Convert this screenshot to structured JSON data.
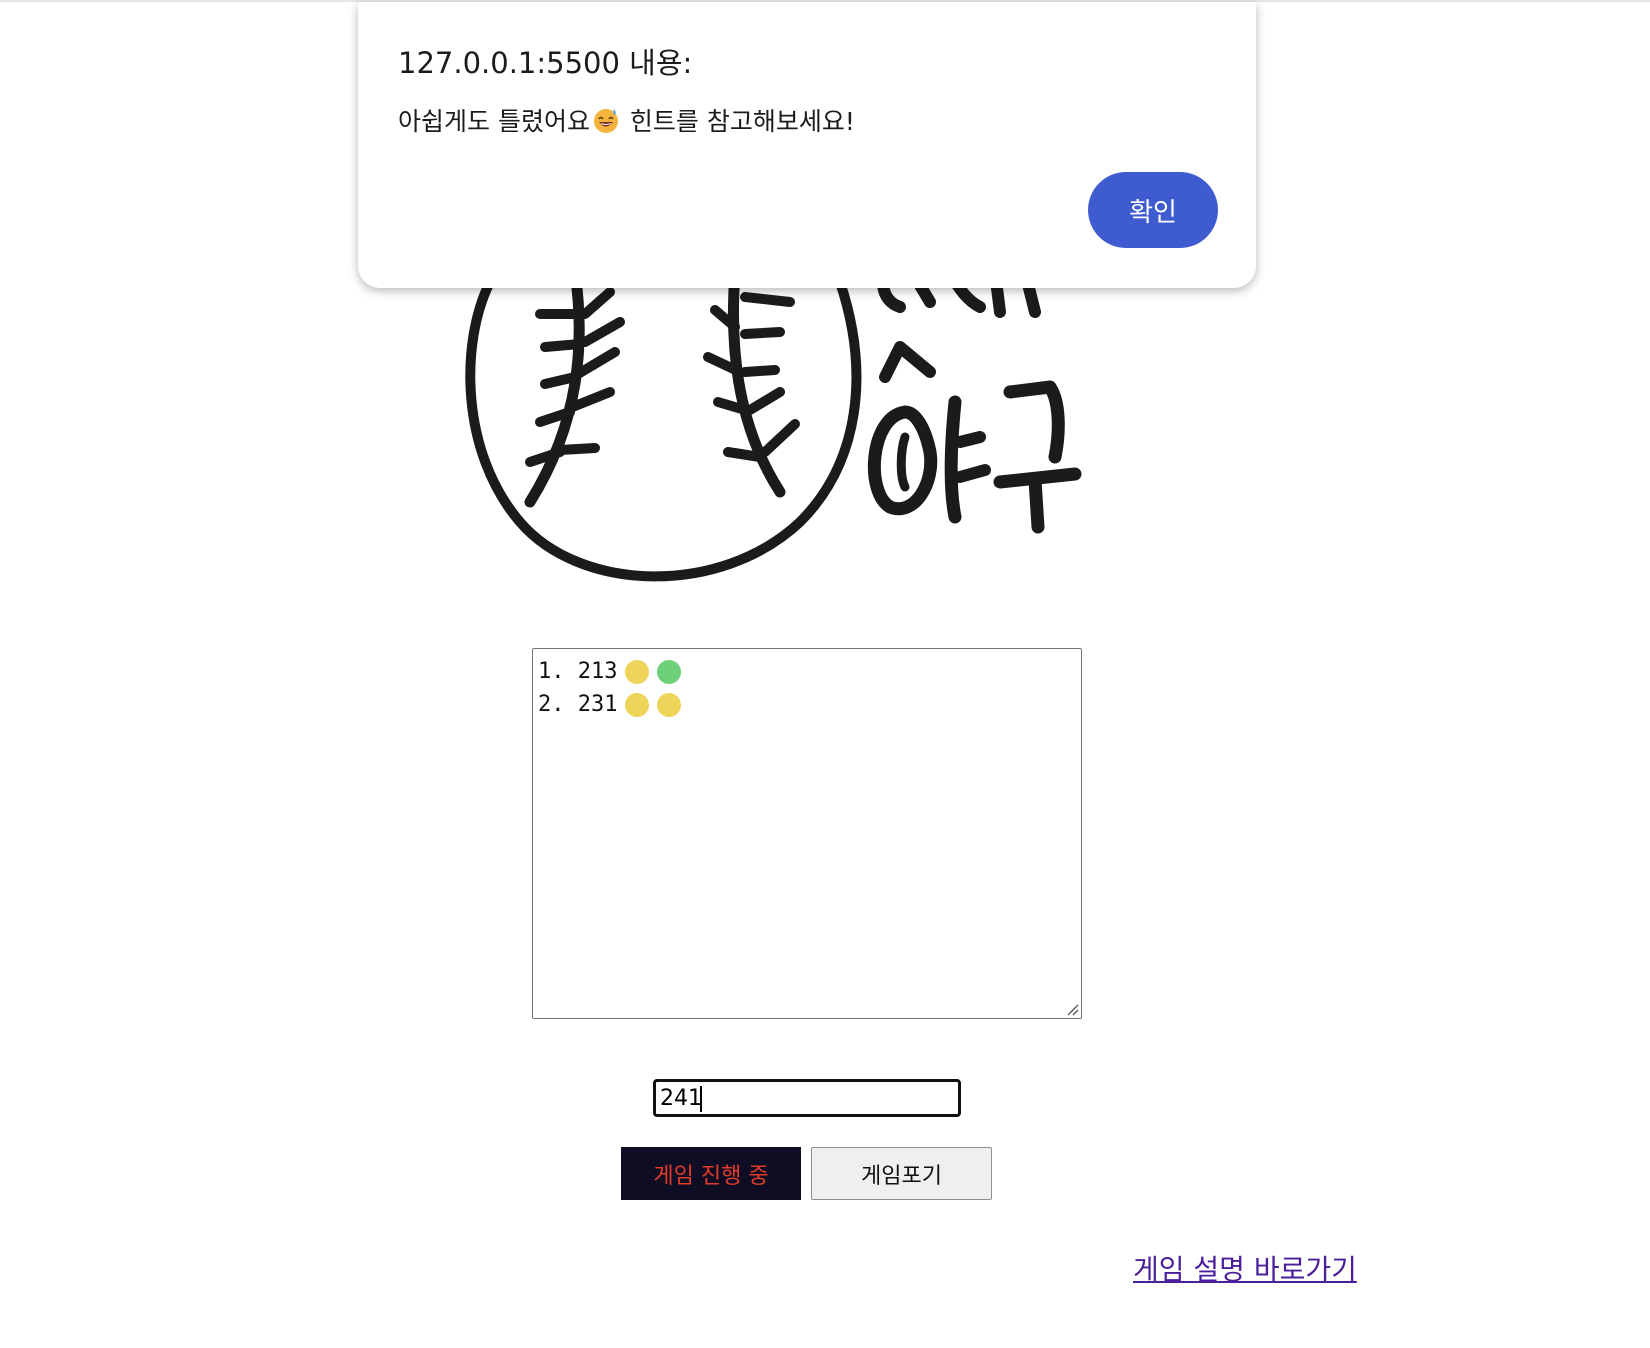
{
  "dialog": {
    "title": "127.0.0.1:5500 내용:",
    "message_before_emoji": "아쉽게도 틀렸어요",
    "emoji": "sweat-smile-emoji",
    "message_after_emoji": " 힌트를 참고해보세요!",
    "ok_label": "확인",
    "ok_color": "#3f5bd0"
  },
  "logo": {
    "description_icon": "baseball-icon",
    "text": "숫자 야구"
  },
  "history": {
    "lines": [
      {
        "label": "1. 213",
        "hints": [
          "ball",
          "strike"
        ]
      },
      {
        "label": "2. 231",
        "hints": [
          "ball",
          "ball"
        ]
      }
    ],
    "hint_colors": {
      "ball": "#efd45a",
      "strike": "#6fd07a"
    }
  },
  "guess": {
    "value": "241"
  },
  "buttons": {
    "status_label": "게임 진행 중",
    "status_bg": "#0f0d24",
    "status_text_color": "#e23b2a",
    "giveup_label": "게임포기"
  },
  "help_link": {
    "label": "게임 설명 바로가기",
    "color": "#4b1f9a"
  }
}
